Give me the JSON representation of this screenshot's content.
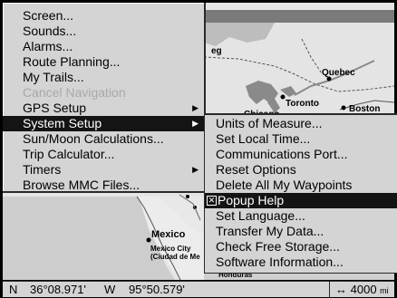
{
  "map": {
    "labels": {
      "toronto": "Toronto",
      "quebec": "Quebec",
      "chicago": "Chicago",
      "boston": "Boston",
      "mexico": "Mexico",
      "mexico_city": "Mexico City",
      "ciudad": "(Ciudad de Me",
      "honduras": "Honduras",
      "partial_top": "eg"
    }
  },
  "main_menu": {
    "items": [
      {
        "label": "Screen...",
        "disabled": false,
        "selected": false,
        "submenu": false
      },
      {
        "label": "Sounds...",
        "disabled": false,
        "selected": false,
        "submenu": false
      },
      {
        "label": "Alarms...",
        "disabled": false,
        "selected": false,
        "submenu": false
      },
      {
        "label": "Route Planning...",
        "disabled": false,
        "selected": false,
        "submenu": false
      },
      {
        "label": "My Trails...",
        "disabled": false,
        "selected": false,
        "submenu": false
      },
      {
        "label": "Cancel Navigation",
        "disabled": true,
        "selected": false,
        "submenu": false
      },
      {
        "label": "GPS Setup",
        "disabled": false,
        "selected": false,
        "submenu": true
      },
      {
        "label": "System Setup",
        "disabled": false,
        "selected": true,
        "submenu": true
      },
      {
        "label": "Sun/Moon Calculations...",
        "disabled": false,
        "selected": false,
        "submenu": false
      },
      {
        "label": "Trip Calculator...",
        "disabled": false,
        "selected": false,
        "submenu": false
      },
      {
        "label": "Timers",
        "disabled": false,
        "selected": false,
        "submenu": true
      },
      {
        "label": "Browse MMC Files...",
        "disabled": false,
        "selected": false,
        "submenu": false
      }
    ],
    "arrow_glyph": "▶"
  },
  "sub_menu": {
    "items": [
      {
        "label": "Units of Measure...",
        "selected": false
      },
      {
        "label": "Set Local Time...",
        "selected": false
      },
      {
        "label": "Communications Port...",
        "selected": false
      },
      {
        "label": "Reset Options",
        "selected": false
      },
      {
        "label": "Delete All My Waypoints",
        "selected": false
      },
      {
        "label": "Popup Help",
        "selected": true,
        "checkbox": true,
        "checked": true
      },
      {
        "label": "Set Language...",
        "selected": false
      },
      {
        "label": "Transfer My Data...",
        "selected": false
      },
      {
        "label": "Check Free Storage...",
        "selected": false
      },
      {
        "label": "Software Information...",
        "selected": false
      }
    ],
    "check_glyph": "✕"
  },
  "status_bar": {
    "lat_hemisphere": "N",
    "lat_value": "36°08.971'",
    "lon_hemisphere": "W",
    "lon_value": "95°50.579'",
    "zoom_icon": "↔",
    "zoom_value": "4000",
    "zoom_unit": "mi"
  },
  "colors": {
    "menu_bg": "#d4d4d4",
    "selected_bg": "#141414",
    "disabled_text": "#a8a8a8",
    "map_land": "#e6e6e6",
    "map_water": "#cfcfcf"
  }
}
